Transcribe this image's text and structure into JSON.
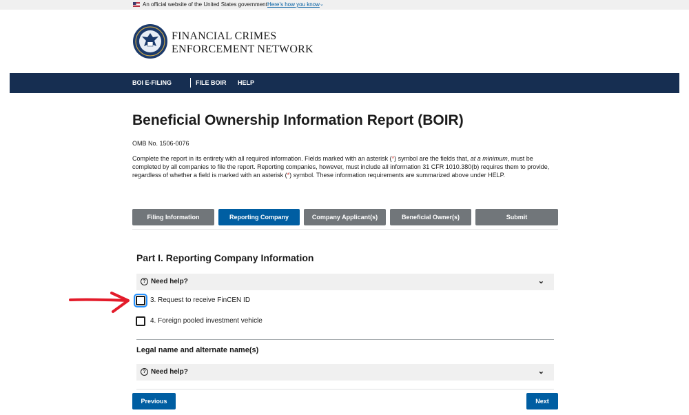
{
  "gov_banner": {
    "text": "An official website of the United States government",
    "link": "Here’s how you know"
  },
  "agency": {
    "line1": "FINANCIAL CRIMES",
    "line2": "ENFORCEMENT NETWORK"
  },
  "nav": {
    "items": [
      "BOI E-FILING",
      "FILE BOIR",
      "HELP"
    ]
  },
  "page": {
    "title": "Beneficial Ownership Information Report (BOIR)",
    "omb": "OMB No. 1506-0076",
    "intro_a": "Complete the report in its entirety with all required information. Fields marked with an asterisk (",
    "asterisk": "*",
    "intro_b": ") symbol are the fields that, ",
    "intro_em": "at a minimum",
    "intro_c": ", must be completed by all companies to file the report. Reporting companies, however, must include all information 31 CFR 1010.380(b) requires them to provide, regardless of whether a field is marked with an asterisk (",
    "intro_d": ") symbol. These information requirements are summarized above under HELP."
  },
  "steps": [
    {
      "label": "Filing Information",
      "active": false
    },
    {
      "label": "Reporting Company",
      "active": true
    },
    {
      "label": "Company Applicant(s)",
      "active": false
    },
    {
      "label": "Beneficial Owner(s)",
      "active": false
    },
    {
      "label": "Submit",
      "active": false
    }
  ],
  "part1": {
    "title": "Part I. Reporting Company Information",
    "help_label": "Need help?",
    "checkbox3": "3. Request to receive FinCEN ID",
    "checkbox4": "4. Foreign pooled investment vehicle"
  },
  "legal": {
    "title": "Legal name and alternate name(s)",
    "help_label": "Need help?"
  },
  "buttons": {
    "previous": "Previous",
    "next": "Next"
  },
  "colors": {
    "nav_bg": "#162e51",
    "primary": "#005ea2",
    "inactive_step": "#71767a",
    "annotation_arrow": "#e31b2a"
  }
}
